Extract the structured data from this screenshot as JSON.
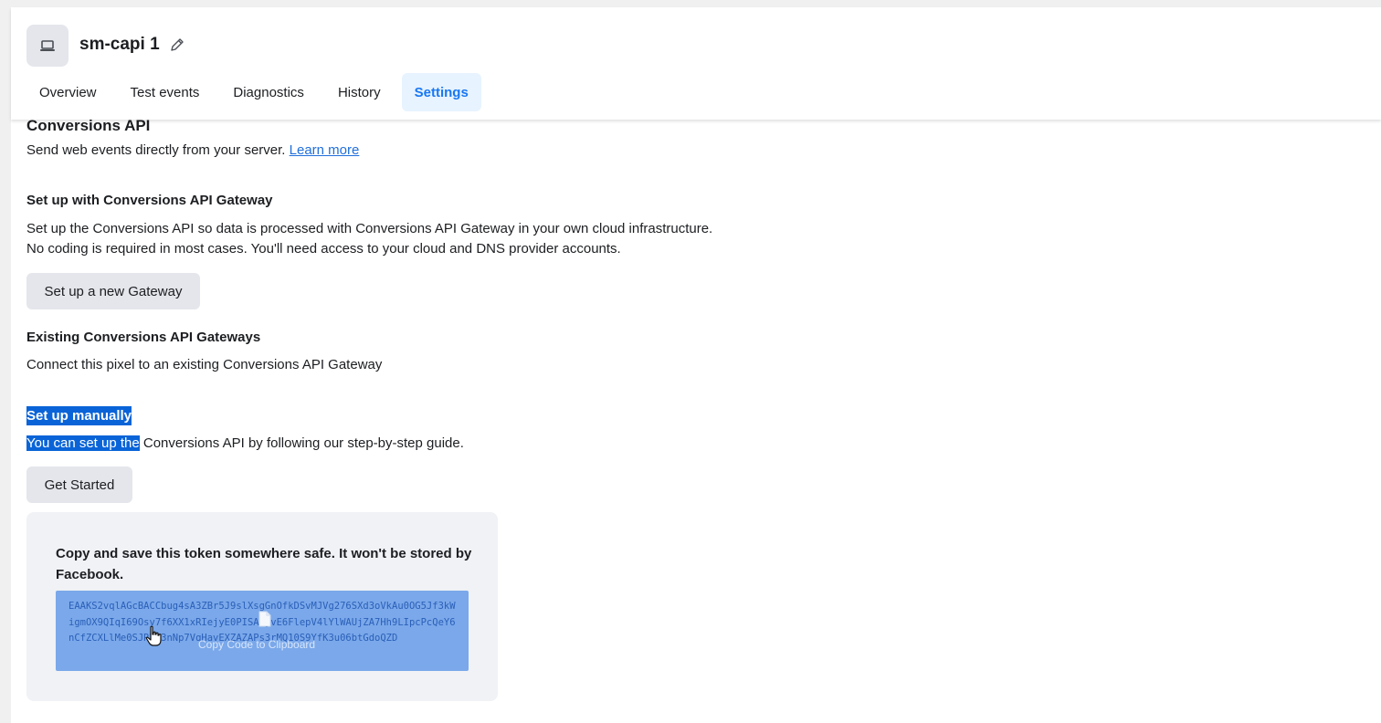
{
  "header": {
    "title": "sm-capi 1",
    "tabs": [
      {
        "label": "Overview"
      },
      {
        "label": "Test events"
      },
      {
        "label": "Diagnostics"
      },
      {
        "label": "History"
      },
      {
        "label": "Settings"
      }
    ],
    "active_tab": "Settings"
  },
  "conversions_api": {
    "title": "Conversions API",
    "description": "Send web events directly from your server.",
    "learn_more": "Learn more"
  },
  "gateway": {
    "title": "Set up with Conversions API Gateway",
    "line1": "Set up the Conversions API so data is processed with Conversions API Gateway in your own cloud infrastructure.",
    "line2": "No coding is required in most cases. You'll need access to your cloud and DNS provider accounts.",
    "button": "Set up a new Gateway"
  },
  "existing": {
    "title": "Existing Conversions API Gateways",
    "description": "Connect this pixel to an existing Conversions API Gateway"
  },
  "manual": {
    "title": "Set up manually",
    "desc_selected": "You can set up the",
    "desc_rest": " Conversions API by following our step-by-step guide.",
    "button": "Get Started"
  },
  "token": {
    "message": "Copy and save this token somewhere safe. It won't be stored by Facebook.",
    "value": "EAAKS2vqlAGcBACCbug4sA3ZBr5J9slXsgGnOfkDSvMJVg276SXd3oVkAu0OG5Jf3kWigmOX9QIqI69Osv7f6XX1xRIejyE0PISAljvE6FlepV4lYlWAUjZA7Hh9LIpcPcQeY6nCfZCXLlMe0SJRYv3nNp7VqHavEXZAZAPs3rMQ10S9YfK3u06btGdoQZD",
    "tooltip": "Copy Code to Clipboard"
  },
  "colors": {
    "accent": "#1877f2",
    "active_tab_bg": "#e7f3ff",
    "button_bg": "#e4e6eb",
    "selection": "#0a64d8",
    "token_bg": "#7aa8ea"
  }
}
